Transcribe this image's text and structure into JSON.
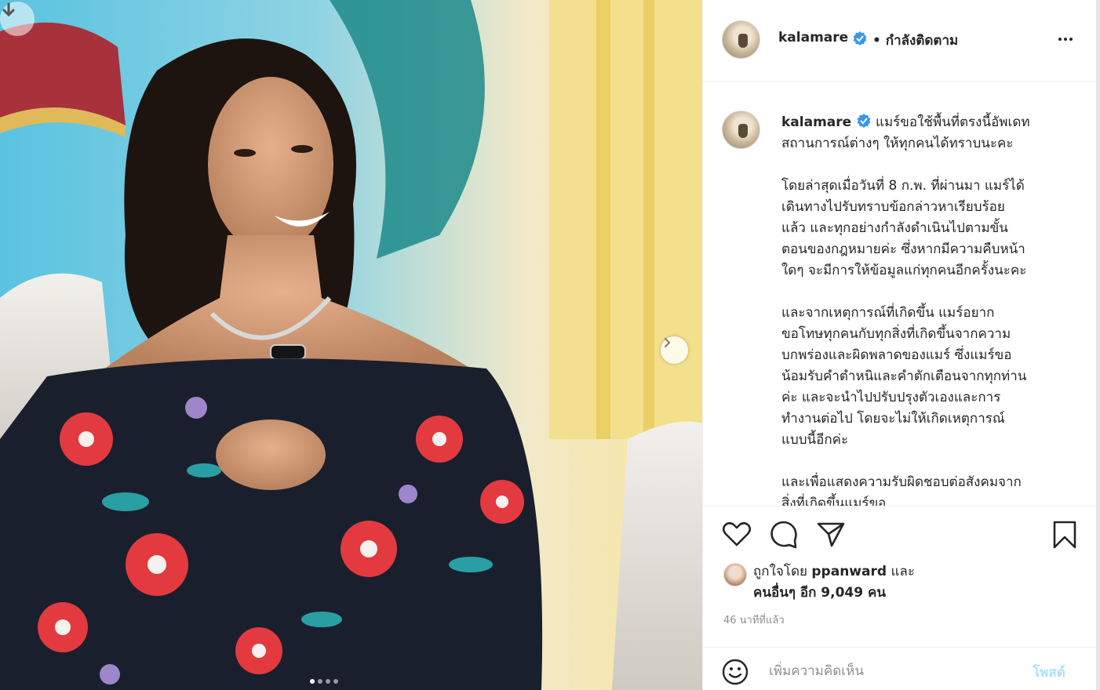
{
  "post": {
    "username": "kalamare",
    "separator": "•",
    "follow_status": "กำลังติดตาม",
    "caption_username": "kalamare",
    "caption": "แมร์ขอใช้พื้นที่ตรงนี้อัพเดท\nสถานการณ์ต่างๆ ให้ทุกคนได้ทราบนะคะ\n\nโดยล่าสุดเมื่อวันที่ 8 ก.พ. ที่ผ่านมา แมร์ได้\nเดินทางไปรับทราบข้อกล่าวหาเรียบร้อย\nแล้ว และทุกอย่างกำลังดำเนินไปตามขั้น\nตอนของกฎหมายค่ะ ซึ่งหากมีความคืบหน้า\nใดๆ จะมีการให้ข้อมูลแก่ทุกคนอีกครั้งนะคะ\n\nและจากเหตุการณ์ที่เกิดขึ้น แมร์อยาก\nขอโทษทุกคนกับทุกสิ่งที่เกิดขึ้นจากความ\nบกพร่องและผิดพลาดของแมร์ ซึ่งแมร์ขอ\nน้อมรับคำตำหนิและคำตักเตือนจากทุกท่าน\nค่ะ และจะนำไปปรับปรุงตัวเองและการ\nทำงานต่อไป โดยจะไม่ให้เกิดเหตุการณ์\nแบบนี้อีกค่ะ\n\nและเพื่อแสดงความรับผิดชอบต่อสังคมจาก\nสิ่งที่เกิดขึ้นแมร์ขอ",
    "likes_prefix": "ถูกใจโดย",
    "likes_user": "ppanward",
    "likes_and": "และ",
    "likes_others": "คนอื่นๆ อีก 9,049 คน",
    "timestamp": "46 นาทีที่แล้ว"
  },
  "comment": {
    "placeholder": "เพิ่มความคิดเห็น",
    "post_label": "โพสต์"
  },
  "carousel": {
    "slide_count": 4,
    "active_index": 0
  },
  "icons": {
    "download": "download-arrow-icon",
    "next": "chevron-right-icon",
    "verified": "verified-badge-icon",
    "more": "more-options-icon",
    "like": "heart-icon",
    "comment": "comment-bubble-icon",
    "share": "paper-plane-icon",
    "save": "bookmark-icon",
    "emoji": "emoji-smile-icon"
  },
  "colors": {
    "verified_blue": "#3897f0",
    "post_button_disabled": "#b2dffc",
    "muted_text": "#8e8e8e"
  }
}
